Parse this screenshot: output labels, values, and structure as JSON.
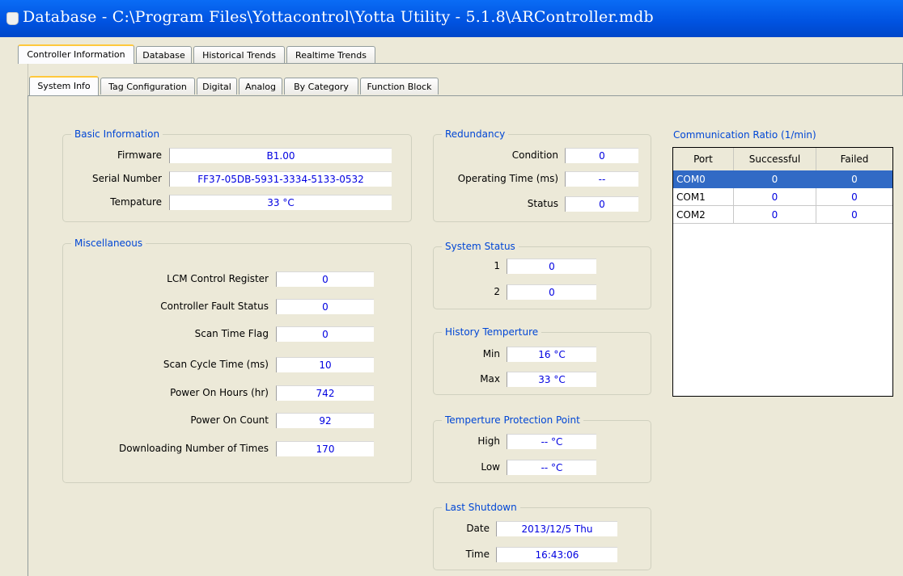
{
  "window": {
    "title": "Database - C:\\Program Files\\Yottacontrol\\Yotta Utility - 5.1.8\\ARController.mdb"
  },
  "main_tabs": [
    "Controller Information",
    "Database",
    "Historical Trends",
    "Realtime Trends"
  ],
  "sub_tabs": [
    "System Info",
    "Tag Configuration",
    "Digital",
    "Analog",
    "By Category",
    "Function Block"
  ],
  "basic": {
    "title": "Basic Information",
    "firmware_label": "Firmware",
    "firmware": "B1.00",
    "serial_label": "Serial Number",
    "serial": "FF37-05DB-5931-3334-5133-0532",
    "temp_label": "Tempature",
    "temp": "33 °C"
  },
  "misc": {
    "title": "Miscellaneous",
    "rows": [
      {
        "label": "LCM Control Register",
        "value": "0"
      },
      {
        "label": "Controller Fault Status",
        "value": "0"
      },
      {
        "label": "Scan Time Flag",
        "value": "0"
      },
      {
        "label": "Scan Cycle Time (ms)",
        "value": "10"
      },
      {
        "label": "Power On Hours (hr)",
        "value": "742"
      },
      {
        "label": "Power On Count",
        "value": "92"
      },
      {
        "label": "Downloading Number of Times",
        "value": "170"
      }
    ]
  },
  "redundancy": {
    "title": "Redundancy",
    "condition_label": "Condition",
    "condition": "0",
    "optime_label": "Operating Time (ms)",
    "optime": "--",
    "status_label": "Status",
    "status": "0"
  },
  "system_status": {
    "title": "System Status",
    "label1": "1",
    "value1": "0",
    "label2": "2",
    "value2": "0"
  },
  "history_temp": {
    "title": "History Temperture",
    "min_label": "Min",
    "min": "16 °C",
    "max_label": "Max",
    "max": "33 °C"
  },
  "temp_protect": {
    "title": "Temperture Protection Point",
    "high_label": "High",
    "high": "-- °C",
    "low_label": "Low",
    "low": "-- °C"
  },
  "last_shutdown": {
    "title": "Last Shutdown",
    "date_label": "Date",
    "date": "2013/12/5  Thu",
    "time_label": "Time",
    "time": "16:43:06"
  },
  "comm": {
    "title": "Communication Ratio (1/min)",
    "headers": [
      "Port",
      "Successful",
      "Failed"
    ],
    "rows": [
      {
        "port": "COM0",
        "successful": "0",
        "failed": "0"
      },
      {
        "port": "COM1",
        "successful": "0",
        "failed": "0"
      },
      {
        "port": "COM2",
        "successful": "0",
        "failed": "0"
      }
    ]
  },
  "colors": {
    "titlebar": "#0054e3",
    "group_title": "#0046d5",
    "value_text": "#0000e0",
    "selection": "#316ac5"
  }
}
